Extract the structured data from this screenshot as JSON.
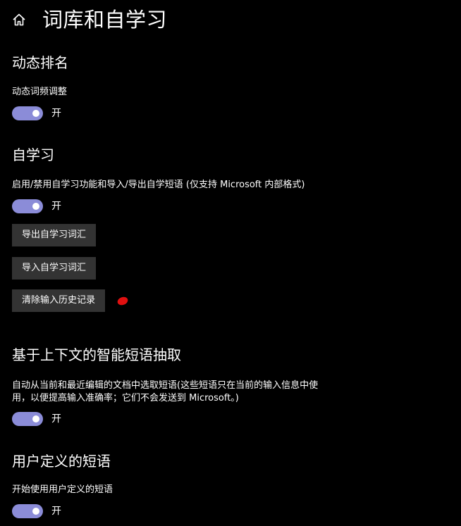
{
  "header": {
    "title": "词库和自学习",
    "home_icon": "home-icon"
  },
  "sections": [
    {
      "title": "动态排名",
      "description": "动态词频调整",
      "toggle_state": "开",
      "toggle_on": true
    },
    {
      "title": "自学习",
      "description": "启用/禁用自学习功能和导入/导出自学短语 (仅支持 Microsoft 内部格式)",
      "toggle_state": "开",
      "toggle_on": true,
      "buttons": {
        "export_label": "导出自学习词汇",
        "import_label": "导入自学习词汇",
        "clear_label": "清除输入历史记录"
      }
    },
    {
      "title": "基于上下文的智能短语抽取",
      "description": "自动从当前和最近编辑的文档中选取短语(这些短语只在当前的输入信息中使用，以便提高输入准确率；它们不会发送到 Microsoft。)",
      "toggle_state": "开",
      "toggle_on": true
    },
    {
      "title": "用户定义的短语",
      "description": "开始使用用户定义的短语",
      "toggle_state": "开",
      "toggle_on": true
    }
  ],
  "colors": {
    "background": "#000000",
    "toggle_on": "#8b8cd8",
    "button_bg": "#333333",
    "annotation_red": "#e01010"
  }
}
